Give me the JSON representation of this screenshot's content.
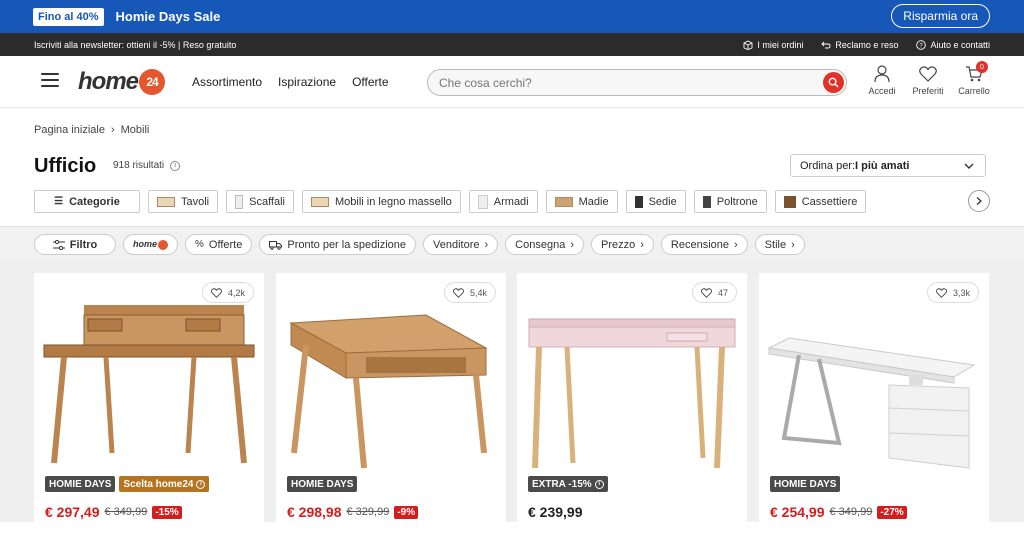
{
  "promo": {
    "badge": "Fino al 40%",
    "title": "Homie Days Sale",
    "button": "Risparmia ora"
  },
  "topbar": {
    "newsletter": "Iscriviti alla newsletter: ottieni il -5% | Reso gratuito",
    "links": [
      "I miei ordini",
      "Reclamo e reso",
      "Aiuto e contatti"
    ]
  },
  "header": {
    "logo_text": "home",
    "logo_number": "24",
    "nav": [
      "Assortimento",
      "Ispirazione",
      "Offerte"
    ],
    "search_placeholder": "Che cosa cerchi?",
    "icons": [
      {
        "label": "Accedi",
        "icon": "user-icon"
      },
      {
        "label": "Preferiti",
        "icon": "heart-icon"
      },
      {
        "label": "Carrello",
        "icon": "cart-icon"
      }
    ],
    "cart_count": "0"
  },
  "breadcrumb": [
    "Pagina iniziale",
    "Mobili"
  ],
  "page": {
    "title": "Ufficio",
    "results": "918 risultati"
  },
  "sort": {
    "prefix": "Ordina per:",
    "value": "I più amati"
  },
  "categories": [
    "Categorie",
    "Tavoli",
    "Scaffali",
    "Mobili in legno massello",
    "Armadi",
    "Madie",
    "Sedie",
    "Poltrone",
    "Cassettiere"
  ],
  "filters": {
    "filter_button": "Filtro",
    "chips": [
      "Offerte",
      "Pronto per la spedizione",
      "Venditore",
      "Consegna",
      "Prezzo",
      "Recensione",
      "Stile"
    ]
  },
  "products": [
    {
      "likes": "4,2k",
      "badges": [
        "HOMIE DAYS",
        "Scelta home24"
      ],
      "price": "€ 297,49",
      "old_price": "€ 349,99",
      "discount": "-15%"
    },
    {
      "likes": "5,4k",
      "badges": [
        "HOMIE DAYS"
      ],
      "price": "€ 298,98",
      "old_price": "€ 329,99",
      "discount": "-9%"
    },
    {
      "likes": "47",
      "badges": [
        "EXTRA -15%"
      ],
      "price": "€ 239,99",
      "old_price": "",
      "discount": ""
    },
    {
      "likes": "3,3k",
      "badges": [
        "HOMIE DAYS"
      ],
      "price": "€ 254,99",
      "old_price": "€ 349,99",
      "discount": "-27%"
    }
  ],
  "colors": {
    "brand_blue": "#1757b8",
    "accent_red": "#d41e1e",
    "logo_orange": "#e4572e",
    "badge_brown": "#b5741f"
  }
}
